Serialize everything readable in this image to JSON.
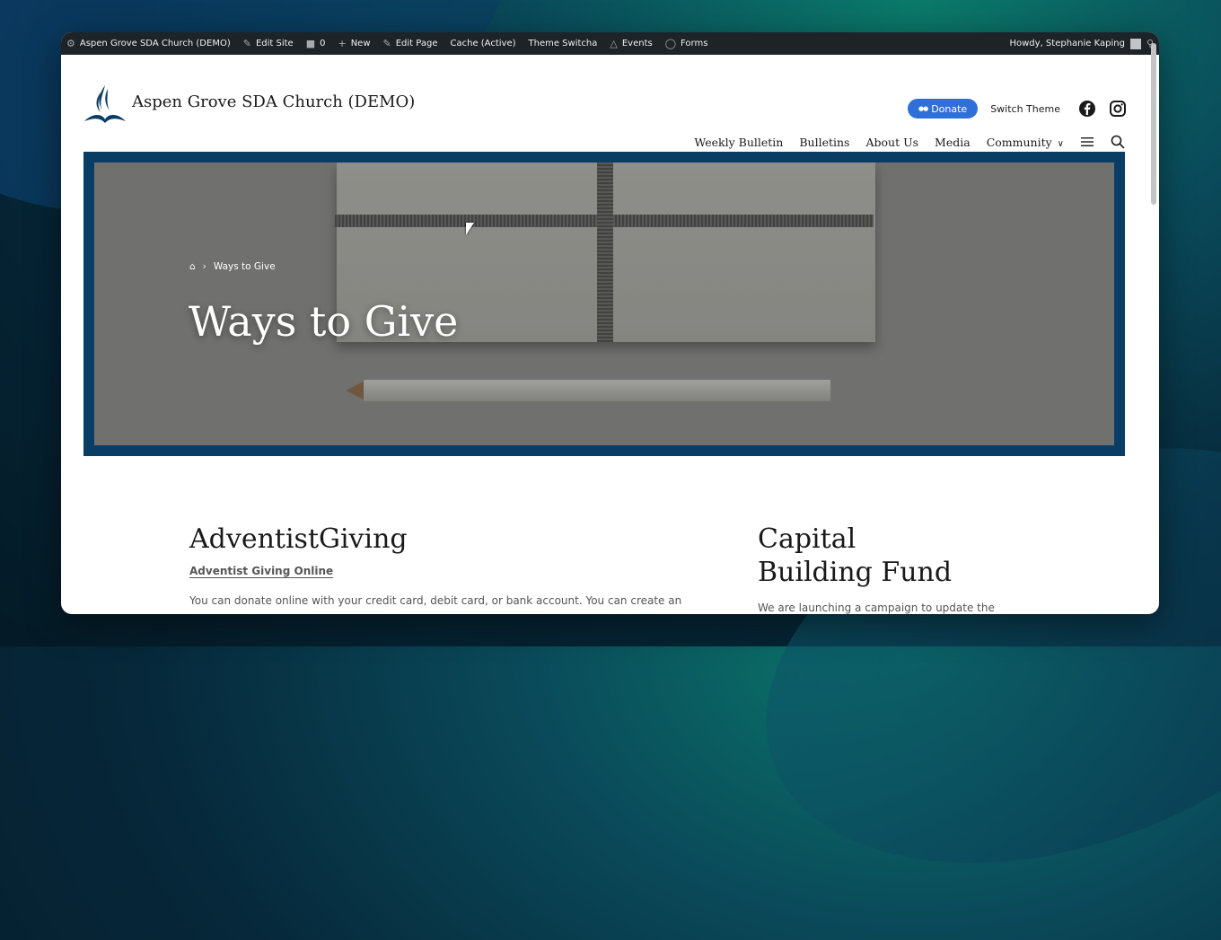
{
  "adminbar": {
    "site_name": "Aspen Grove SDA Church (DEMO)",
    "edit_site": "Edit Site",
    "comments_count": "0",
    "new": "New",
    "edit_page": "Edit Page",
    "cache": "Cache (Active)",
    "theme_switcha": "Theme Switcha",
    "events": "Events",
    "forms": "Forms",
    "howdy": "Howdy, Stephanie Kaping"
  },
  "header": {
    "site_title": "Aspen Grove SDA Church (DEMO)",
    "donate_label": "Donate",
    "switch_theme_label": "Switch Theme"
  },
  "nav": {
    "items": [
      "Weekly Bulletin",
      "Bulletins",
      "About Us",
      "Media",
      "Community"
    ]
  },
  "hero": {
    "breadcrumb_current": "Ways to Give",
    "title": "Ways to Give"
  },
  "content": {
    "left": {
      "heading": "AdventistGiving",
      "link": "Adventist Giving Online",
      "paragraph": "You can donate online with your credit card, debit card, or bank account. You can create an"
    },
    "right": {
      "heading_line1": "Capital",
      "heading_line2": "Building Fund",
      "paragraph": "We are launching a campaign to update the"
    }
  },
  "colors": {
    "adminbar_bg": "#1d2327",
    "donate_bg": "#2f6fd8",
    "hero_frame": "#0a3d63"
  }
}
